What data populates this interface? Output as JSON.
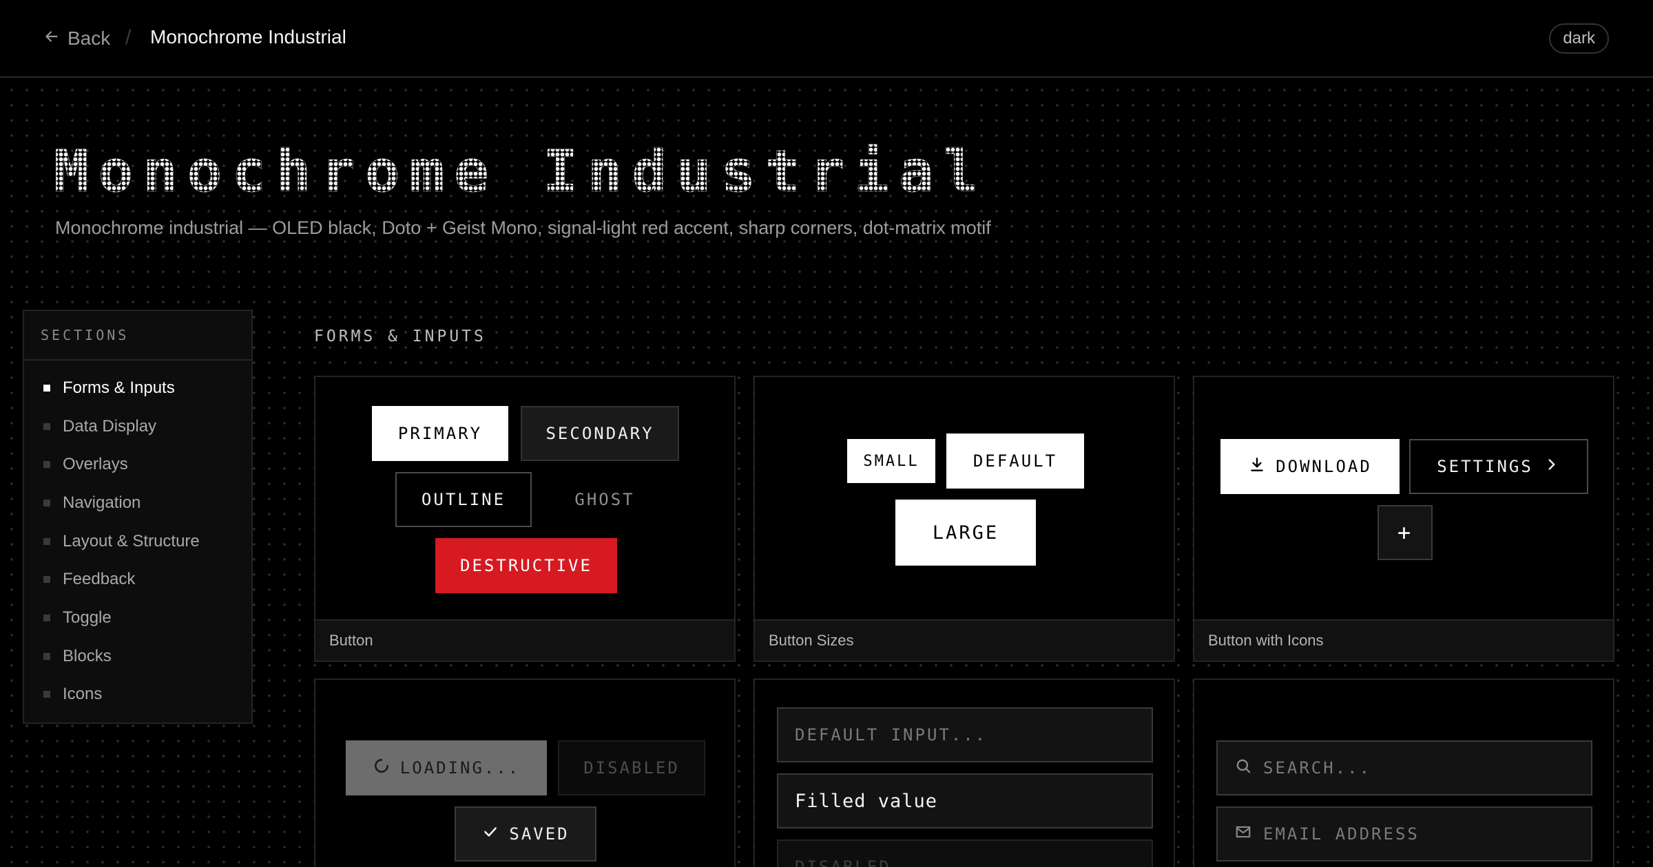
{
  "topbar": {
    "back_label": "Back",
    "separator": "/",
    "title": "Monochrome Industrial",
    "theme": "dark"
  },
  "hero": {
    "title": "Monochrome Industrial",
    "subtitle": "Monochrome industrial — OLED black, Doto + Geist Mono, signal-light red accent, sharp corners, dot-matrix motif"
  },
  "sidebar": {
    "heading": "SECTIONS",
    "items": [
      {
        "label": "Forms & Inputs",
        "active": true
      },
      {
        "label": "Data Display"
      },
      {
        "label": "Overlays"
      },
      {
        "label": "Navigation"
      },
      {
        "label": "Layout & Structure"
      },
      {
        "label": "Feedback"
      },
      {
        "label": "Toggle"
      },
      {
        "label": "Blocks"
      },
      {
        "label": "Icons"
      }
    ]
  },
  "section": {
    "label": "FORMS & INPUTS"
  },
  "cards": {
    "button": {
      "footer": "Button",
      "primary": "PRIMARY",
      "secondary": "SECONDARY",
      "outline": "OUTLINE",
      "ghost": "GHOST",
      "destructive": "DESTRUCTIVE"
    },
    "sizes": {
      "footer": "Button Sizes",
      "small": "SMALL",
      "default": "DEFAULT",
      "large": "LARGE"
    },
    "icons": {
      "footer": "Button with Icons",
      "download": "DOWNLOAD",
      "settings": "SETTINGS",
      "add": "+"
    },
    "states": {
      "loading": "LOADING...",
      "disabled": "DISABLED",
      "saved": "SAVED"
    },
    "inputs": {
      "default_placeholder": "DEFAULT INPUT...",
      "filled_value": "Filled value",
      "disabled_placeholder": "DISABLED..."
    },
    "icon_inputs": {
      "search_placeholder": "SEARCH...",
      "email_placeholder": "EMAIL ADDRESS"
    }
  },
  "colors": {
    "background": "#000000",
    "accent": "#d71921",
    "surface": "#111111",
    "border": "#242424"
  }
}
